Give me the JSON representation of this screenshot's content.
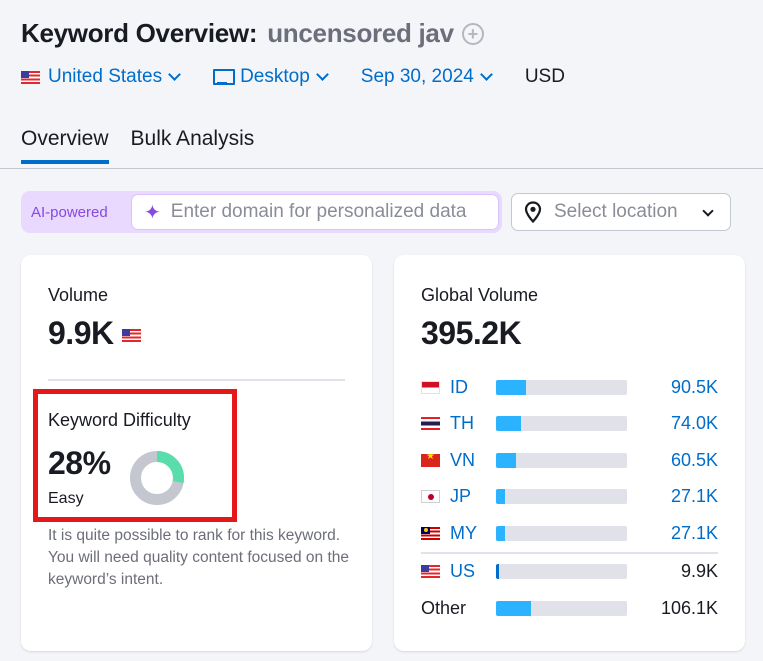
{
  "header": {
    "title": "Keyword Overview:",
    "keyword": "uncensored jav",
    "add_icon": "plus-circle-icon"
  },
  "filters": {
    "country": "United States",
    "device": "Desktop",
    "date": "Sep 30, 2024",
    "currency": "USD"
  },
  "tabs": [
    {
      "label": "Overview",
      "active": true
    },
    {
      "label": "Bulk Analysis",
      "active": false
    }
  ],
  "ai_search": {
    "badge": "AI-powered",
    "placeholder": "Enter domain for personalized data",
    "value": ""
  },
  "location_select": {
    "placeholder": "Select location"
  },
  "volume": {
    "label": "Volume",
    "value": "9.9K",
    "country_flag": "US"
  },
  "keyword_difficulty": {
    "label": "Keyword Difficulty",
    "value": "28%",
    "percent": 28,
    "level": "Easy",
    "description": "It is quite possible to rank for this keyword. You will need quality content focused on the keyword’s intent.",
    "colors": {
      "filled": "#59ddaa",
      "empty": "#c4c7cf"
    }
  },
  "global_volume": {
    "label": "Global Volume",
    "value": "395.2K",
    "top_countries": [
      {
        "code": "ID",
        "value": "90.5K",
        "share": 0.23
      },
      {
        "code": "TH",
        "value": "74.0K",
        "share": 0.19
      },
      {
        "code": "VN",
        "value": "60.5K",
        "share": 0.15
      },
      {
        "code": "JP",
        "value": "27.1K",
        "share": 0.07
      },
      {
        "code": "MY",
        "value": "27.1K",
        "share": 0.07
      }
    ],
    "us": {
      "code": "US",
      "value": "9.9K",
      "share": 0.025
    },
    "other": {
      "label": "Other",
      "value": "106.1K",
      "share": 0.27
    }
  }
}
